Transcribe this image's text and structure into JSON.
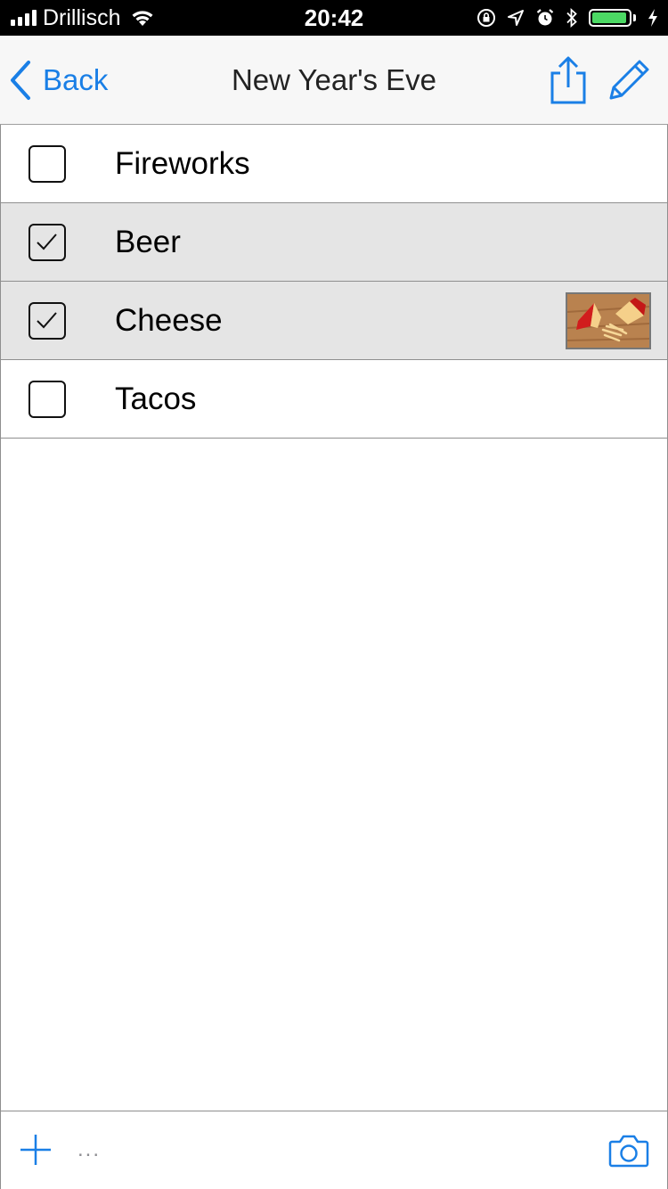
{
  "status_bar": {
    "carrier": "Drillisch",
    "time": "20:42",
    "battery_level": 0.95
  },
  "nav": {
    "back_label": "Back",
    "title": "New Year's Eve",
    "icons": [
      "chevron-left-icon",
      "share-icon",
      "pencil-icon"
    ]
  },
  "items": [
    {
      "label": "Fireworks",
      "checked": false,
      "has_photo": false
    },
    {
      "label": "Beer",
      "checked": true,
      "has_photo": false
    },
    {
      "label": "Cheese",
      "checked": true,
      "has_photo": true
    },
    {
      "label": "Tacos",
      "checked": false,
      "has_photo": false
    }
  ],
  "toolbar": {
    "more_label": "...",
    "icons": [
      "plus-icon",
      "ellipsis-icon",
      "camera-icon"
    ]
  },
  "colors": {
    "accent": "#1a7fe6",
    "checked_row": "#e5e5e5",
    "battery": "#4cd964"
  }
}
